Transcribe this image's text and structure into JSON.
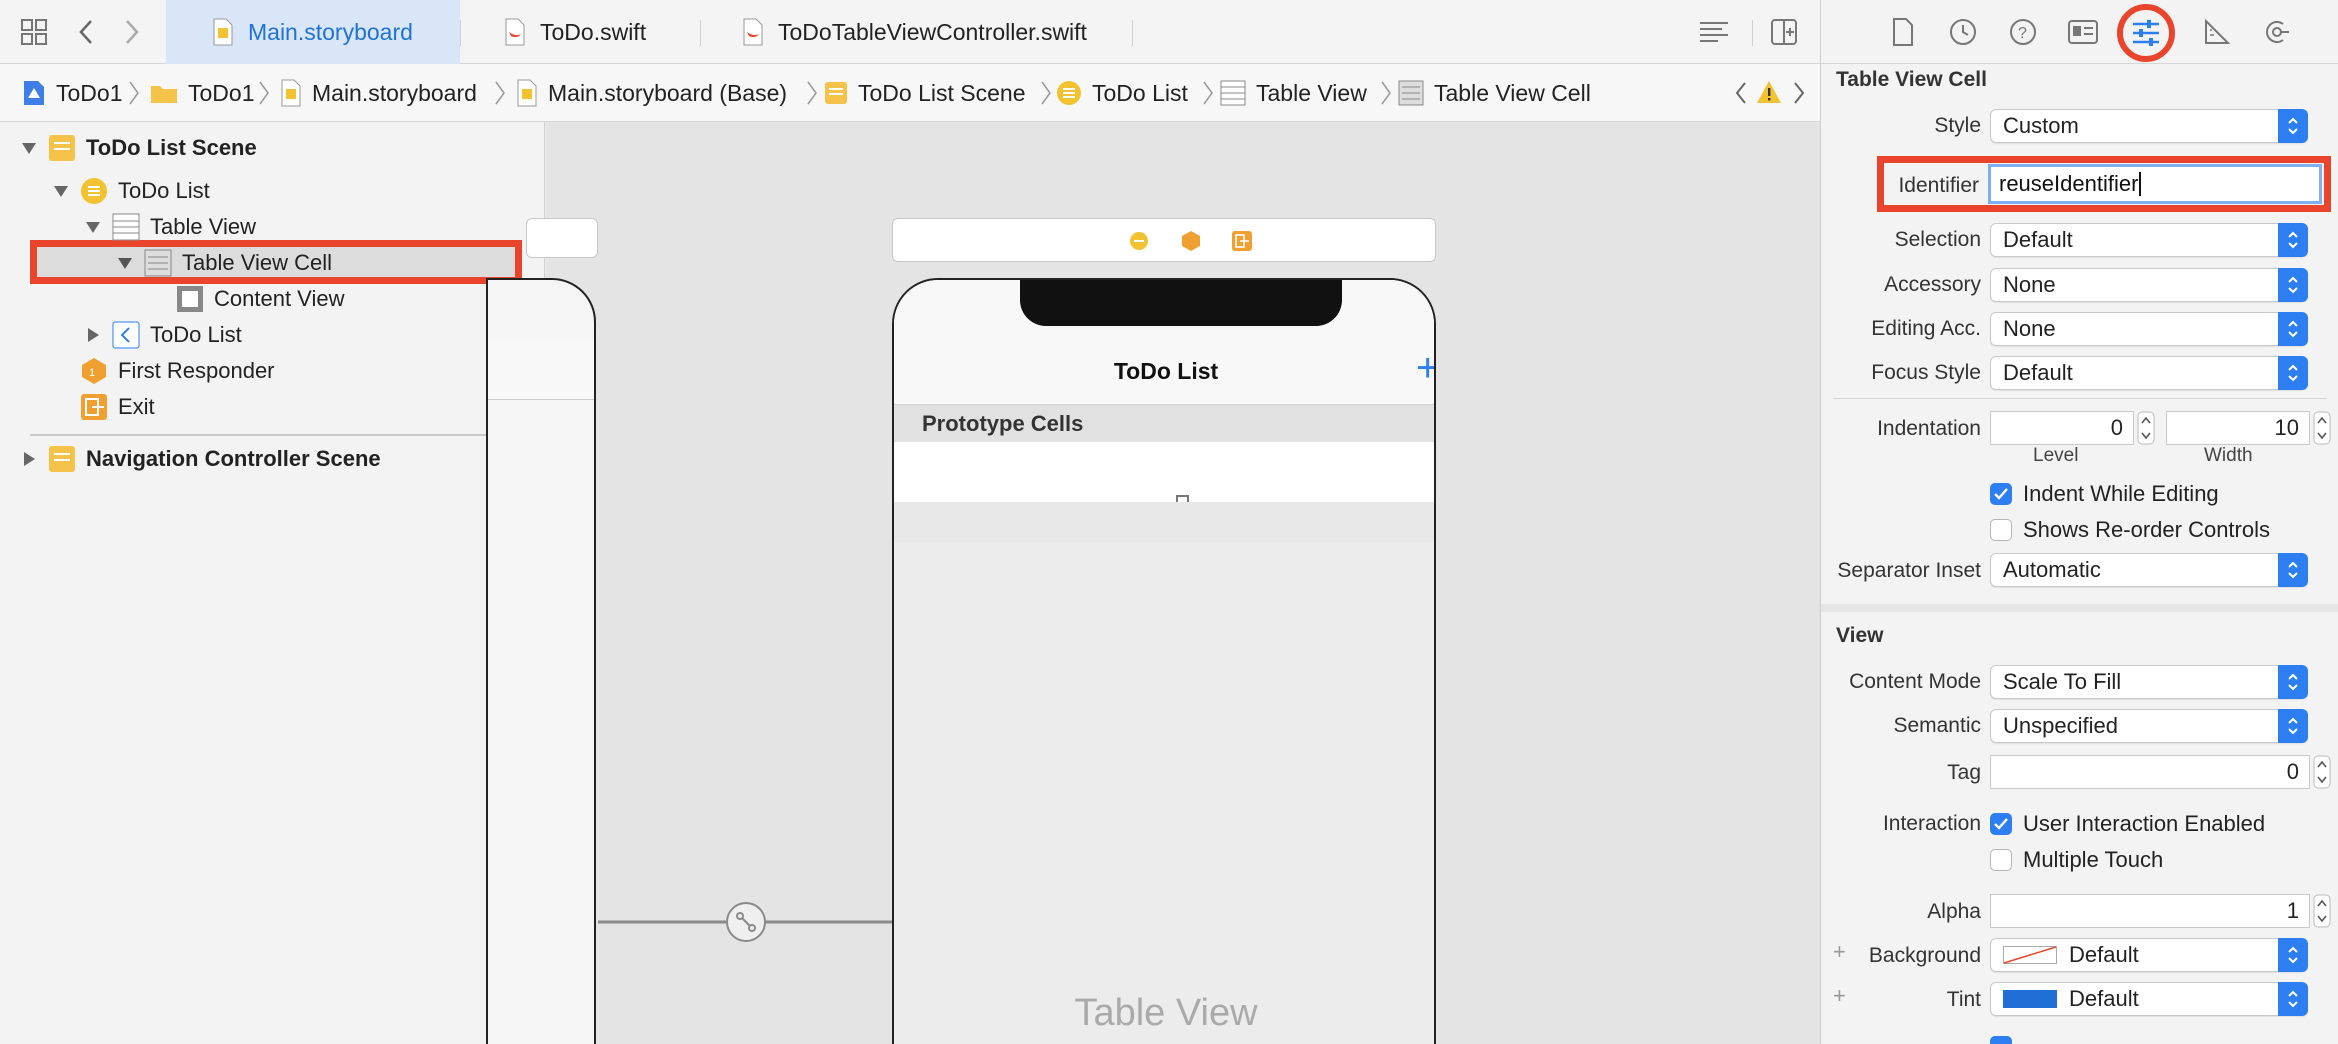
{
  "tabs": [
    {
      "label": "Main.storyboard"
    },
    {
      "label": "ToDo.swift"
    },
    {
      "label": "ToDoTableViewController.swift"
    }
  ],
  "breadcrumb": [
    "ToDo1",
    "ToDo1",
    "Main.storyboard",
    "Main.storyboard (Base)",
    "ToDo List Scene",
    "ToDo List",
    "Table View",
    "Table View Cell"
  ],
  "navigator": {
    "scene1": "ToDo List Scene",
    "todo_list": "ToDo List",
    "table_view": "Table View",
    "table_view_cell": "Table View Cell",
    "content_view": "Content View",
    "todo_list_nav": "ToDo List",
    "first_responder": "First Responder",
    "exit": "Exit",
    "scene2": "Navigation Controller Scene"
  },
  "canvas": {
    "nav_title": "ToDo List",
    "add_button": "+",
    "prototype_cells": "Prototype Cells",
    "table_view_watermark": "Table View"
  },
  "inspector": {
    "cell_section": "Table View Cell",
    "style_label": "Style",
    "style_value": "Custom",
    "identifier_label": "Identifier",
    "identifier_value": "reuseIdentifier",
    "selection_label": "Selection",
    "selection_value": "Default",
    "accessory_label": "Accessory",
    "accessory_value": "None",
    "editing_acc_label": "Editing Acc.",
    "editing_acc_value": "None",
    "focus_style_label": "Focus Style",
    "focus_style_value": "Default",
    "indentation_label": "Indentation",
    "indentation_level": "0",
    "indentation_width": "10",
    "level_label": "Level",
    "width_label": "Width",
    "indent_while_editing": "Indent While Editing",
    "shows_reorder": "Shows Re-order Controls",
    "separator_inset_label": "Separator Inset",
    "separator_inset_value": "Automatic",
    "view_section": "View",
    "content_mode_label": "Content Mode",
    "content_mode_value": "Scale To Fill",
    "semantic_label": "Semantic",
    "semantic_value": "Unspecified",
    "tag_label": "Tag",
    "tag_value": "0",
    "interaction_label": "Interaction",
    "user_interaction": "User Interaction Enabled",
    "multiple_touch": "Multiple Touch",
    "alpha_label": "Alpha",
    "alpha_value": "1",
    "background_label": "Background",
    "background_value": "Default",
    "tint_label": "Tint",
    "tint_value": "Default",
    "plus": "+"
  },
  "colors": {
    "highlight": "#e8452c",
    "accent": "#2d7ef0",
    "tint_swatch": "#1f6fd6"
  }
}
